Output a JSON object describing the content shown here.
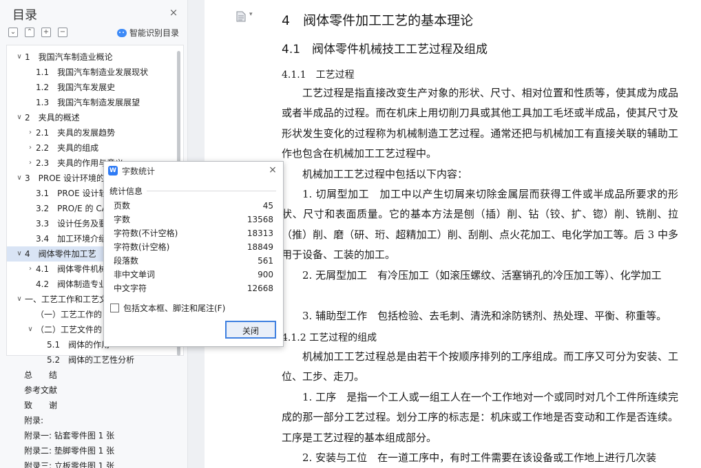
{
  "sidebar": {
    "title": "目录",
    "close_glyph": "×",
    "toolbar": [
      {
        "name": "collapse-all-button",
        "glyph": "⌄"
      },
      {
        "name": "expand-all-button",
        "glyph": "⌃"
      },
      {
        "name": "add-button",
        "glyph": "+"
      },
      {
        "name": "remove-button",
        "glyph": "−"
      }
    ],
    "smart_label": "智能识别目录",
    "toc": [
      {
        "level": 0,
        "arrow": "v",
        "text": "1　我国汽车制造业概论"
      },
      {
        "level": 1,
        "arrow": "",
        "text": "1.1　我国汽车制造业发展现状"
      },
      {
        "level": 1,
        "arrow": "",
        "text": "1.2　我国汽车发展史"
      },
      {
        "level": 1,
        "arrow": "",
        "text": "1.3　我国汽车制造发展展望"
      },
      {
        "level": 0,
        "arrow": "v",
        "text": "2　夹具的概述"
      },
      {
        "level": 1,
        "arrow": ">",
        "text": "2.1　夹具的发展趋势"
      },
      {
        "level": 1,
        "arrow": ">",
        "text": "2.2　夹具的组成"
      },
      {
        "level": 1,
        "arrow": ">",
        "text": "2.3　夹具的作用与意义"
      },
      {
        "level": 0,
        "arrow": "v",
        "text": "3　PROE 设计环境的"
      },
      {
        "level": 1,
        "arrow": "",
        "text": "3.1　PROE 设计软"
      },
      {
        "level": 1,
        "arrow": "",
        "text": "3.2　PRO/E 的 CA"
      },
      {
        "level": 1,
        "arrow": "",
        "text": "3.3　设计任务及要"
      },
      {
        "level": 1,
        "arrow": "",
        "text": "3.4　加工环境介绍"
      },
      {
        "level": 0,
        "arrow": "v",
        "text": "4　阀体零件加工艺",
        "active": true
      },
      {
        "level": 1,
        "arrow": ">",
        "text": "4.1　阀体零件机械"
      },
      {
        "level": 1,
        "arrow": "",
        "text": "4.2　阀体制造专业"
      },
      {
        "level": 0,
        "arrow": "v",
        "text": "一、工艺工作和工艺文"
      },
      {
        "level": 1,
        "arrow": "",
        "text": "（一）工艺工作的"
      },
      {
        "level": 1,
        "arrow": "v",
        "text": "（二）工艺文件的"
      },
      {
        "level": 2,
        "arrow": "",
        "text": "5.1　阀体的作用"
      },
      {
        "level": 2,
        "arrow": "",
        "text": "5.2　阀体的工艺性分析"
      }
    ],
    "extra": [
      "总　　结",
      "参考文献",
      "致　　谢",
      "附录:",
      "附录一: 钻套零件图 1 张",
      "附录二: 垫脚零件图 1 张",
      "附录三: 立板零件图 1 张"
    ]
  },
  "document": {
    "h1": "4　阀体零件加工工艺的基本理论",
    "h2": "4.1　阀体零件机械技工工艺过程及组成",
    "h3a": "4.1.1　工艺过程",
    "p1": "工艺过程是指直接改变生产对象的形状、尺寸、相对位置和性质等，使其成为成品或者半成品的过程。而在机床上用切削刀具或其他工具加工毛坯或半成品，使其尺寸及形状发生变化的过程称为机械制造工艺过程。通常还把与机械加工有直接关联的辅助工作也包含在机械加工工艺过程中。",
    "p2": "机械加工工艺过程中包括以下内容：",
    "p3": "1. 切屑型加工　加工中以产生切屑来切除金属层而获得工件或半成品所要求的形状、尺寸和表面质量。它的基本方法是刨（插）削、钻（铰、扩、锪）削、铣削、拉（推）削、磨（研、珩、超精加工）削、刮削、点火花加工、电化学加工等。后 3 中多用于设备、工装的加工。",
    "p4": "2. 无屑型加工　有冷压加工（如滚压螺纹、活塞销孔的冷压加工等）、化学加工",
    "p5": "3. 辅助型工作　包括检验、去毛刺、清洗和涂防锈剂、热处理、平衡、称重等。",
    "h3b": "4.1.2 工艺过程的组成",
    "p6": "机械加工工艺过程总是由若干个按顺序排列的工序组成。而工序又可分为安装、工位、工步、走刀。",
    "p7": "1. 工序　是指一个工人或一组工人在一个工作地对一个或同时对几个工件所连续完成的那一部分工艺过程。划分工序的标志是：机床或工作地是否变动和工作是否连续。工序是工艺过程的基本组成部分。",
    "p8": "2. 安装与工位　在一道工序中，有时工件需要在该设备或工作地上进行几次装"
  },
  "dialog": {
    "title": "字数统计",
    "close_glyph": "×",
    "section": "统计信息",
    "stats": [
      {
        "label": "页数",
        "value": "45"
      },
      {
        "label": "字数",
        "value": "13568"
      },
      {
        "label": "字符数(不计空格)",
        "value": "18313"
      },
      {
        "label": "字符数(计空格)",
        "value": "18849"
      },
      {
        "label": "段落数",
        "value": "561"
      },
      {
        "label": "非中文单词",
        "value": "900"
      },
      {
        "label": "中文字符",
        "value": "12668"
      }
    ],
    "include_label": "包括文本框、脚注和尾注(F)",
    "include_checked": false,
    "ok_label": "关闭"
  },
  "colors": {
    "accent": "#3d7fe0",
    "active_row": "#d9e4f5",
    "sidebar_bg": "#f7f8fa",
    "doc_bg": "#eef0f3"
  },
  "icons": [
    "close-icon",
    "chevron-down-icon",
    "chevron-right-icon",
    "smart-toc-icon",
    "document-icon",
    "wps-app-icon",
    "checkbox-icon"
  ]
}
